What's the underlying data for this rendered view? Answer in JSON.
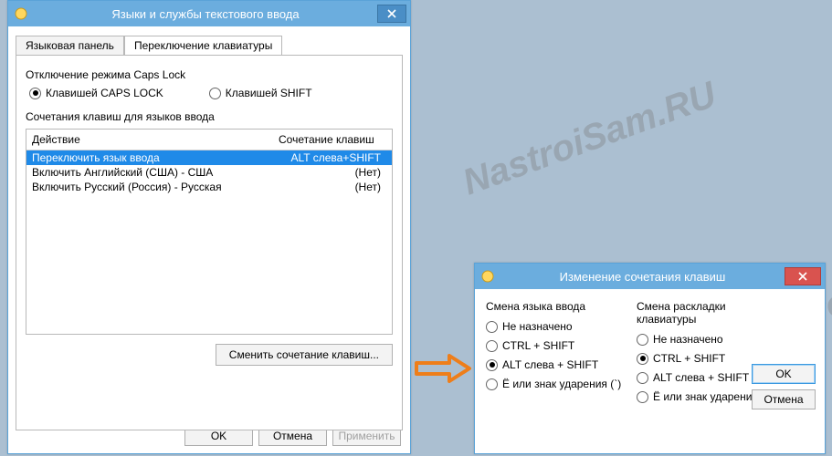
{
  "dialog1": {
    "title": "Языки и службы текстового ввода",
    "tabs": {
      "lang_panel": "Языковая панель",
      "switch_kbd": "Переключение клавиатуры"
    },
    "capslock_group": "Отключение режима Caps Lock",
    "radio_caps": "Клавишей CAPS LOCK",
    "radio_shift": "Клавишей SHIFT",
    "hotkeys_group": "Сочетания клавиш для языков ввода",
    "col_action": "Действие",
    "col_keys": "Сочетание клавиш",
    "rows": [
      {
        "action": "Переключить язык ввода",
        "keys": "ALT слева+SHIFT"
      },
      {
        "action": "Включить Английский (США) - США",
        "keys": "(Нет)"
      },
      {
        "action": "Включить Русский (Россия) - Русская",
        "keys": "(Нет)"
      }
    ],
    "change_btn": "Сменить сочетание клавиш...",
    "ok": "OK",
    "cancel": "Отмена",
    "apply": "Применить"
  },
  "dialog2": {
    "title": "Изменение сочетания клавиш",
    "left_heading": "Смена языка ввода",
    "right_heading": "Смена раскладки клавиатуры",
    "opt_none": "Не назначено",
    "opt_ctrlshift": "CTRL + SHIFT",
    "opt_altshift": "ALT слева + SHIFT",
    "opt_grave": "Ё или знак ударения (`)",
    "ok": "OK",
    "cancel": "Отмена"
  },
  "watermark": "NastroiSam.RU"
}
